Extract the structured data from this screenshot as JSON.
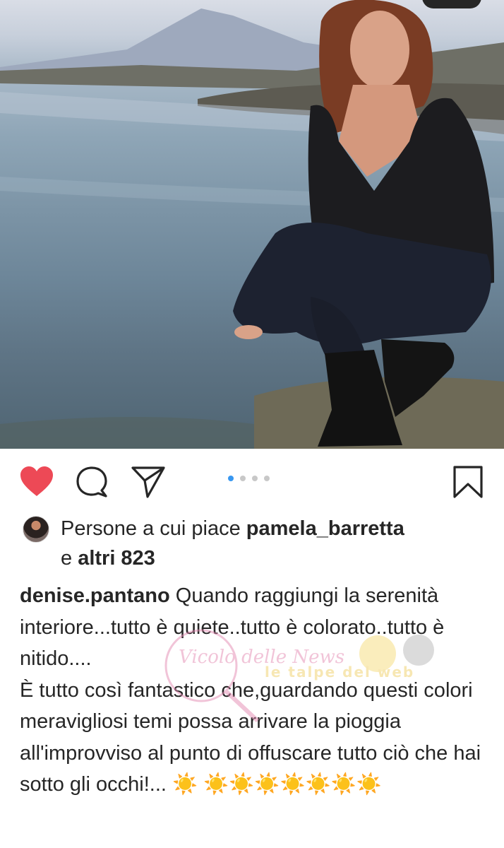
{
  "post": {
    "image_alt": "Woman crouching on the rocky seashore at sunset with a mountain in the background",
    "carousel": {
      "total": 4,
      "active": 1
    }
  },
  "actions": {
    "like_icon": "heart-filled-icon",
    "comment_icon": "comment-icon",
    "share_icon": "send-icon",
    "save_icon": "bookmark-icon",
    "like_color": "#ed4956"
  },
  "likes": {
    "prefix": "Persone a cui piace ",
    "user": "pamela_barretta",
    "joiner": "e ",
    "others": "altri 823"
  },
  "caption": {
    "author": "denise.pantano",
    "text": " Quando raggiungi la serenità interiore...tutto è quiete..tutto è colorato..tutto è nitido....\nÈ tutto così fantastico che,guardando questi colori meravigliosi temi possa arrivare la pioggia all'improvviso al punto di offuscare tutto ciò che hai sotto gli occhi!... ☀️ ☀️☀️☀️☀️☀️☀️☀️"
  },
  "watermark": {
    "text1": "Vicolo delle News",
    "text2": "le talpe del web"
  },
  "colors": {
    "accent": "#3897f0",
    "text": "#262626"
  }
}
